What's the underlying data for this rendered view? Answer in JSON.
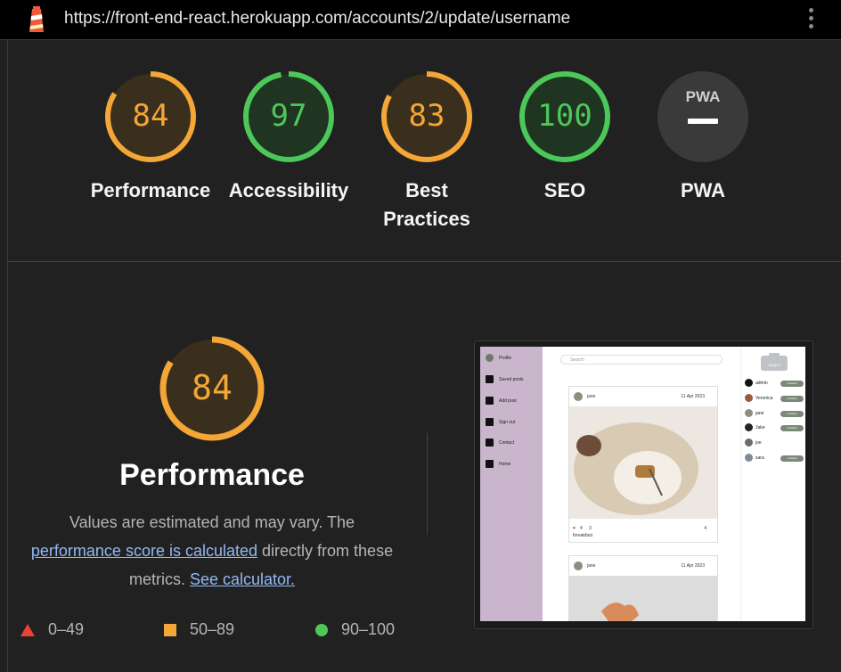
{
  "browser": {
    "url": "https://front-end-react.herokuapp.com/accounts/2/update/username"
  },
  "colors": {
    "average": "#f4a636",
    "pass": "#4cc859",
    "fail": "#eb4134",
    "pwa_bg": "#3a3a3a"
  },
  "gauges": [
    {
      "label": "Performance",
      "score": "84",
      "value": 0.84,
      "status": "average"
    },
    {
      "label": "Accessibility",
      "score": "97",
      "value": 0.97,
      "status": "pass"
    },
    {
      "label": "Best Practices",
      "score": "83",
      "value": 0.83,
      "status": "average"
    },
    {
      "label": "SEO",
      "score": "100",
      "value": 1.0,
      "status": "pass"
    },
    {
      "label": "PWA",
      "score": "PWA",
      "status": "na"
    }
  ],
  "performance": {
    "score": "84",
    "value": 0.84,
    "title": "Performance",
    "desc_before": "Values are estimated and may vary. The",
    "link1": "performance score is calculated",
    "desc_middle": "directly from these metrics.",
    "link2": "See calculator."
  },
  "legend": [
    {
      "range": "0–49",
      "shape": "triangle",
      "color": "#eb4134"
    },
    {
      "range": "50–89",
      "shape": "square",
      "color": "#f4a636"
    },
    {
      "range": "90–100",
      "shape": "circle",
      "color": "#4cc859"
    }
  ],
  "screenshot": {
    "sidebar": [
      "Profile",
      "Saved posts",
      "Add post",
      "Sign out",
      "Contact",
      "Home"
    ],
    "search_placeholder": "Search",
    "logo_text": "snap it",
    "posts": [
      {
        "author": "jane",
        "date": "11 Apr 2023",
        "likes": "4",
        "comments": "3",
        "saves": "4",
        "caption": "foreakfast"
      },
      {
        "author": "jane",
        "date": "11 Apr 2023"
      }
    ],
    "users": [
      {
        "name": "admin",
        "unfollow": "unfollow"
      },
      {
        "name": "Veronica",
        "unfollow": "unfollow"
      },
      {
        "name": "jane",
        "unfollow": "unfollow"
      },
      {
        "name": "Jake",
        "unfollow": "unfollow"
      },
      {
        "name": "joe",
        "unfollow": ""
      },
      {
        "name": "sara",
        "unfollow": "unfollow"
      }
    ]
  }
}
